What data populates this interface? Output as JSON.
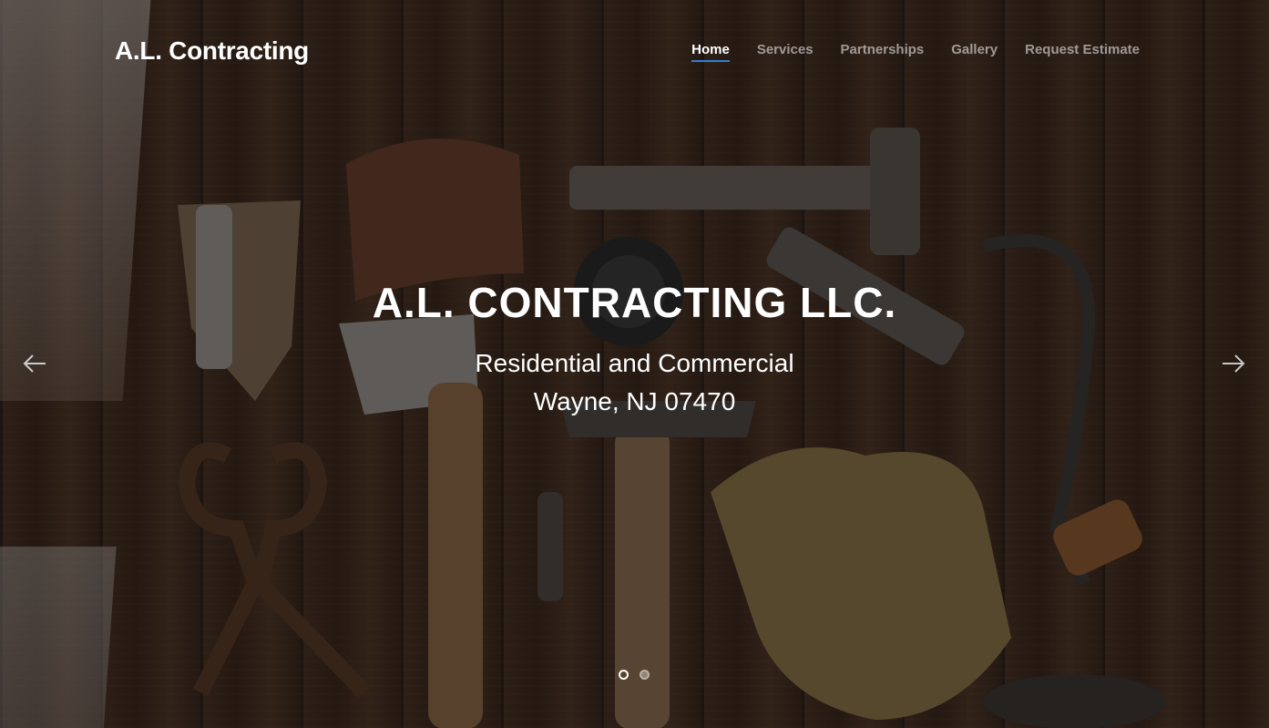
{
  "navbar": {
    "brand": "A.L. Contracting",
    "items": [
      {
        "label": "Home",
        "active": true
      },
      {
        "label": "Services",
        "active": false
      },
      {
        "label": "Partnerships",
        "active": false
      },
      {
        "label": "Gallery",
        "active": false
      },
      {
        "label": "Request Estimate",
        "active": false
      }
    ]
  },
  "hero": {
    "title": "A.L. CONTRACTING LLC.",
    "subtitle_line1": "Residential and Commercial",
    "subtitle_line2": "Wayne, NJ 07470"
  },
  "carousel": {
    "prev_icon": "arrow-left-icon",
    "next_icon": "arrow-right-icon",
    "slide_count": 2,
    "active_slide": 1
  },
  "colors": {
    "accent": "#2f7fd6",
    "text": "#ffffff",
    "nav_muted": "rgba(255,255,255,0.55)"
  }
}
